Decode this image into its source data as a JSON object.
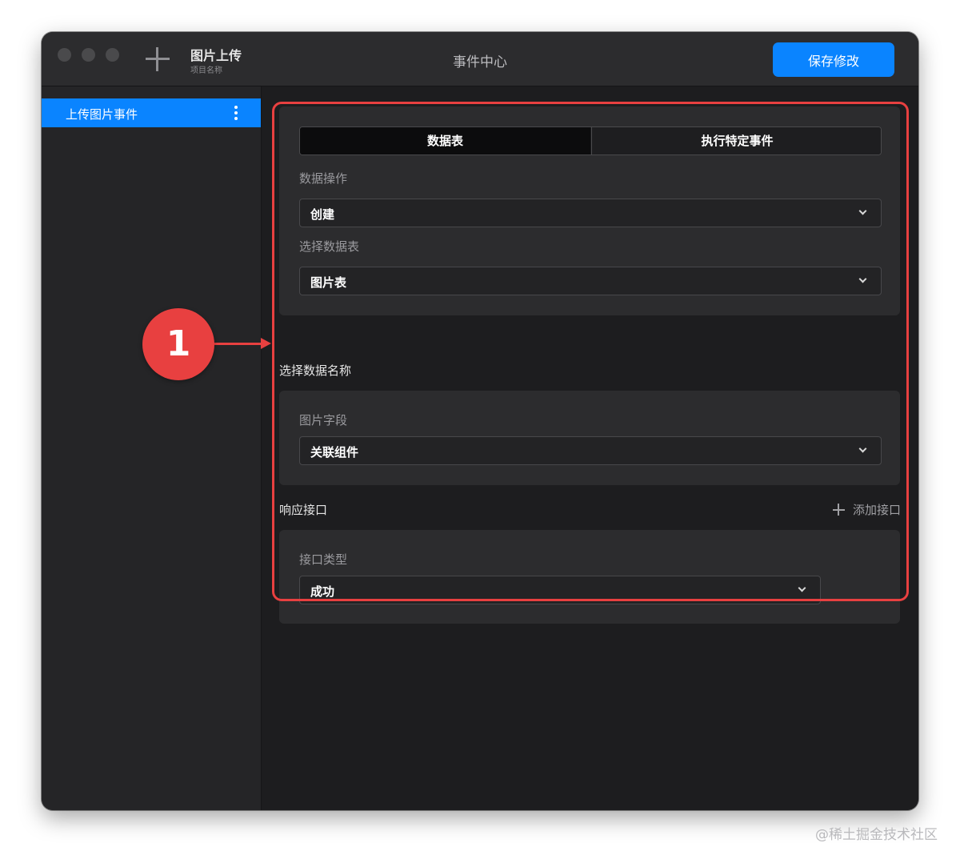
{
  "window": {
    "project_title": "图片上传",
    "project_subtitle": "项目名称",
    "center_title": "事件中心",
    "save_label": "保存修改"
  },
  "sidebar": {
    "items": [
      {
        "label": "上传图片事件",
        "selected": true
      }
    ]
  },
  "main": {
    "tabs": [
      {
        "label": "数据表",
        "active": true
      },
      {
        "label": "执行特定事件",
        "active": false
      }
    ],
    "data_operation": {
      "label": "数据操作",
      "value": "创建"
    },
    "data_table": {
      "label": "选择数据表",
      "value": "图片表"
    },
    "name_section_title": "选择数据名称",
    "image_field": {
      "label": "图片字段",
      "value": "关联组件"
    },
    "response_section_title": "响应接口",
    "add_api_label": "添加接口",
    "api_type": {
      "label": "接口类型",
      "value": "成功"
    }
  },
  "annotation": {
    "callout_number": "1"
  },
  "watermark": "@稀土掘金技术社区",
  "colors": {
    "accent": "#0a84ff",
    "highlight": "#e84040",
    "window_bg": "#1d1d1f",
    "panel_bg": "#2c2c2e"
  },
  "icons": [
    "add-icon",
    "more-vertical-icon",
    "chevron-down-icon",
    "plus-icon"
  ]
}
